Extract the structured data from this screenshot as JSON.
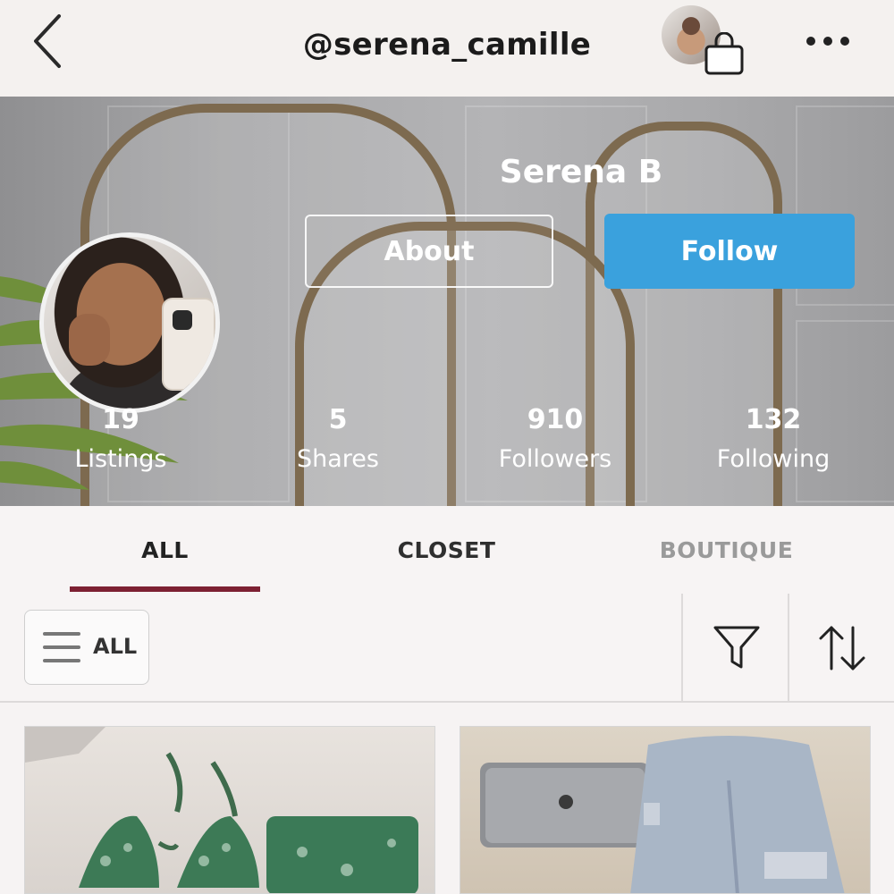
{
  "header": {
    "handle": "@serena_camille"
  },
  "profile": {
    "name": "Serena B",
    "about_label": "About",
    "follow_label": "Follow",
    "stats": [
      {
        "value": "19",
        "label": "Listings"
      },
      {
        "value": "5",
        "label": "Shares"
      },
      {
        "value": "910",
        "label": "Followers"
      },
      {
        "value": "132",
        "label": "Following"
      }
    ]
  },
  "tabs": [
    {
      "label": "ALL",
      "state": "active"
    },
    {
      "label": "CLOSET",
      "state": "normal"
    },
    {
      "label": "BOUTIQUE",
      "state": "disabled"
    }
  ],
  "filter": {
    "category_label": "ALL"
  },
  "icons": [
    "back-icon",
    "shopping-bag-icon",
    "more-icon",
    "menu-icon",
    "filter-icon",
    "sort-icon"
  ],
  "colors": {
    "follow_blue": "#3aa1dd",
    "tab_underline": "#7d2032"
  }
}
